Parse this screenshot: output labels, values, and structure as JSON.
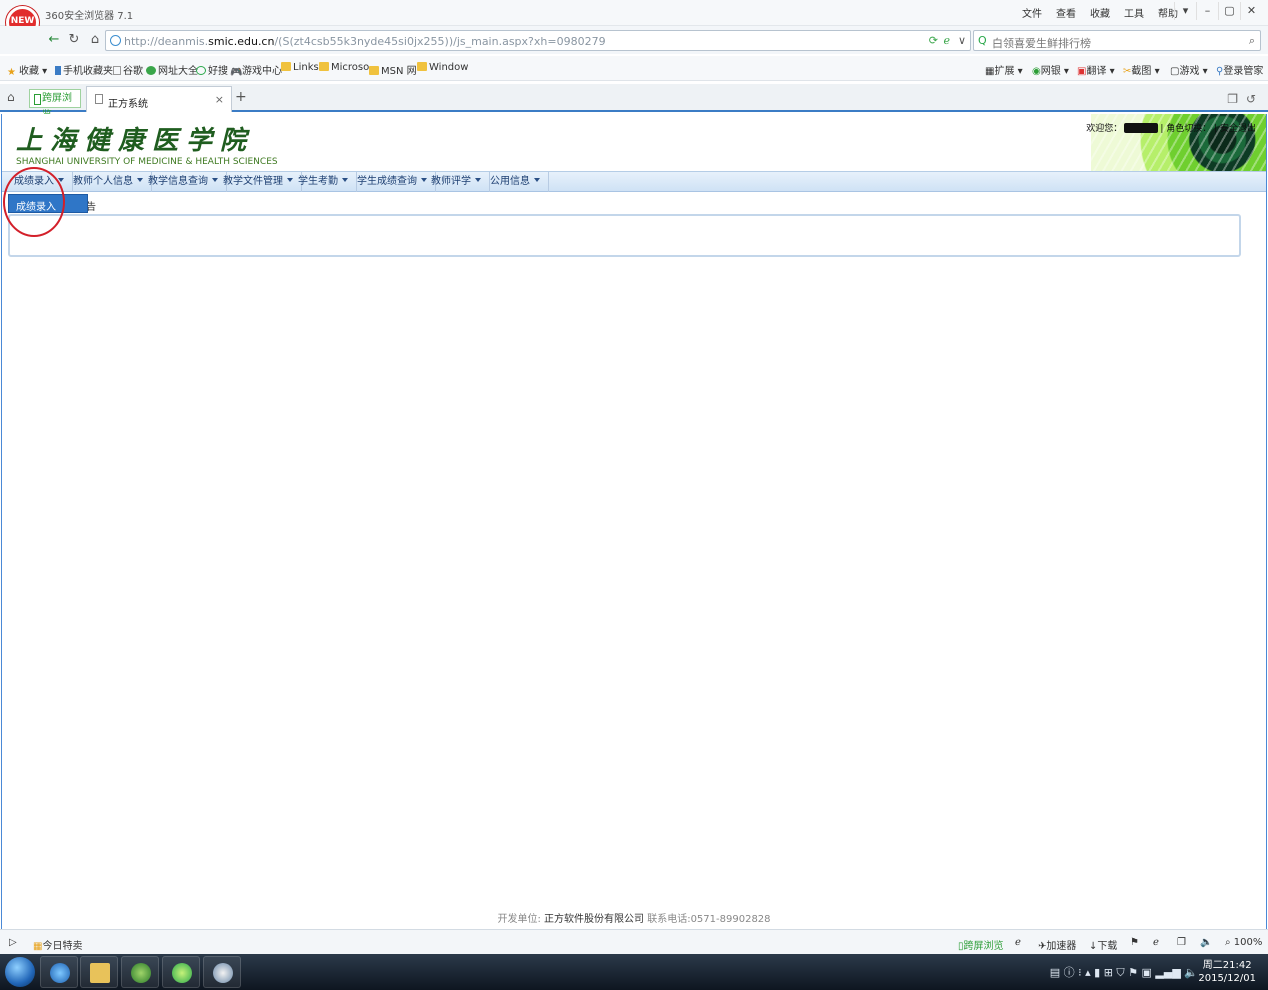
{
  "browser": {
    "app_title": "360安全浏览器 7.1",
    "logo_text": "NEW",
    "menu": [
      "文件",
      "查看",
      "收藏",
      "工具",
      "帮助"
    ],
    "window_controls": [
      "▾",
      "–",
      "▢",
      "✕"
    ],
    "url_prefix": "http://deanmis.",
    "url_domain": "smic.edu.cn",
    "url_rest": "/(S(zt4csb55k3nyde45si0jx255))/js_main.aspx?xh=0980279",
    "search_placeholder": "白领喜爱生鲜排行榜",
    "bookmarks": [
      "收藏",
      "手机收藏夹",
      "谷歌",
      "网址大全",
      "好搜",
      "游戏中心",
      "Links",
      "Microso",
      "MSN 网",
      "Window"
    ],
    "extensions": [
      "扩展",
      "网银",
      "翻译",
      "截图",
      "游戏",
      "登录管家"
    ],
    "tabs": {
      "split_label": "跨屏浏览",
      "active_label": "正方系统",
      "close": "×",
      "new_tab": "+"
    }
  },
  "site": {
    "school_name_cn": "上海健康医学院",
    "school_name_en": "SHANGHAI UNIVERSITY OF MEDICINE & HEALTH SCIENCES",
    "welcome": "欢迎您：",
    "role_switch": "| 角色切换：",
    "logout": "| 安全退出",
    "nav": [
      "成绩录入",
      "教师个人信息",
      "教学信息查询",
      "教学文件管理",
      "学生考勤",
      "学生成绩查询",
      "教师评学",
      "公用信息"
    ],
    "dropdown_option": "成绩录入",
    "behind_text": "告",
    "footer_dev_label": "开发单位:",
    "footer_company": "正方软件股份有限公司",
    "footer_contact": "联系电话:0571-89902828"
  },
  "statusbar": {
    "today": "今日特卖",
    "items": [
      "跨屏浏览",
      "加速器",
      "下载",
      "100%"
    ]
  },
  "taskbar": {
    "clock_day": "周二21:42",
    "clock_date": "2015/12/01"
  }
}
